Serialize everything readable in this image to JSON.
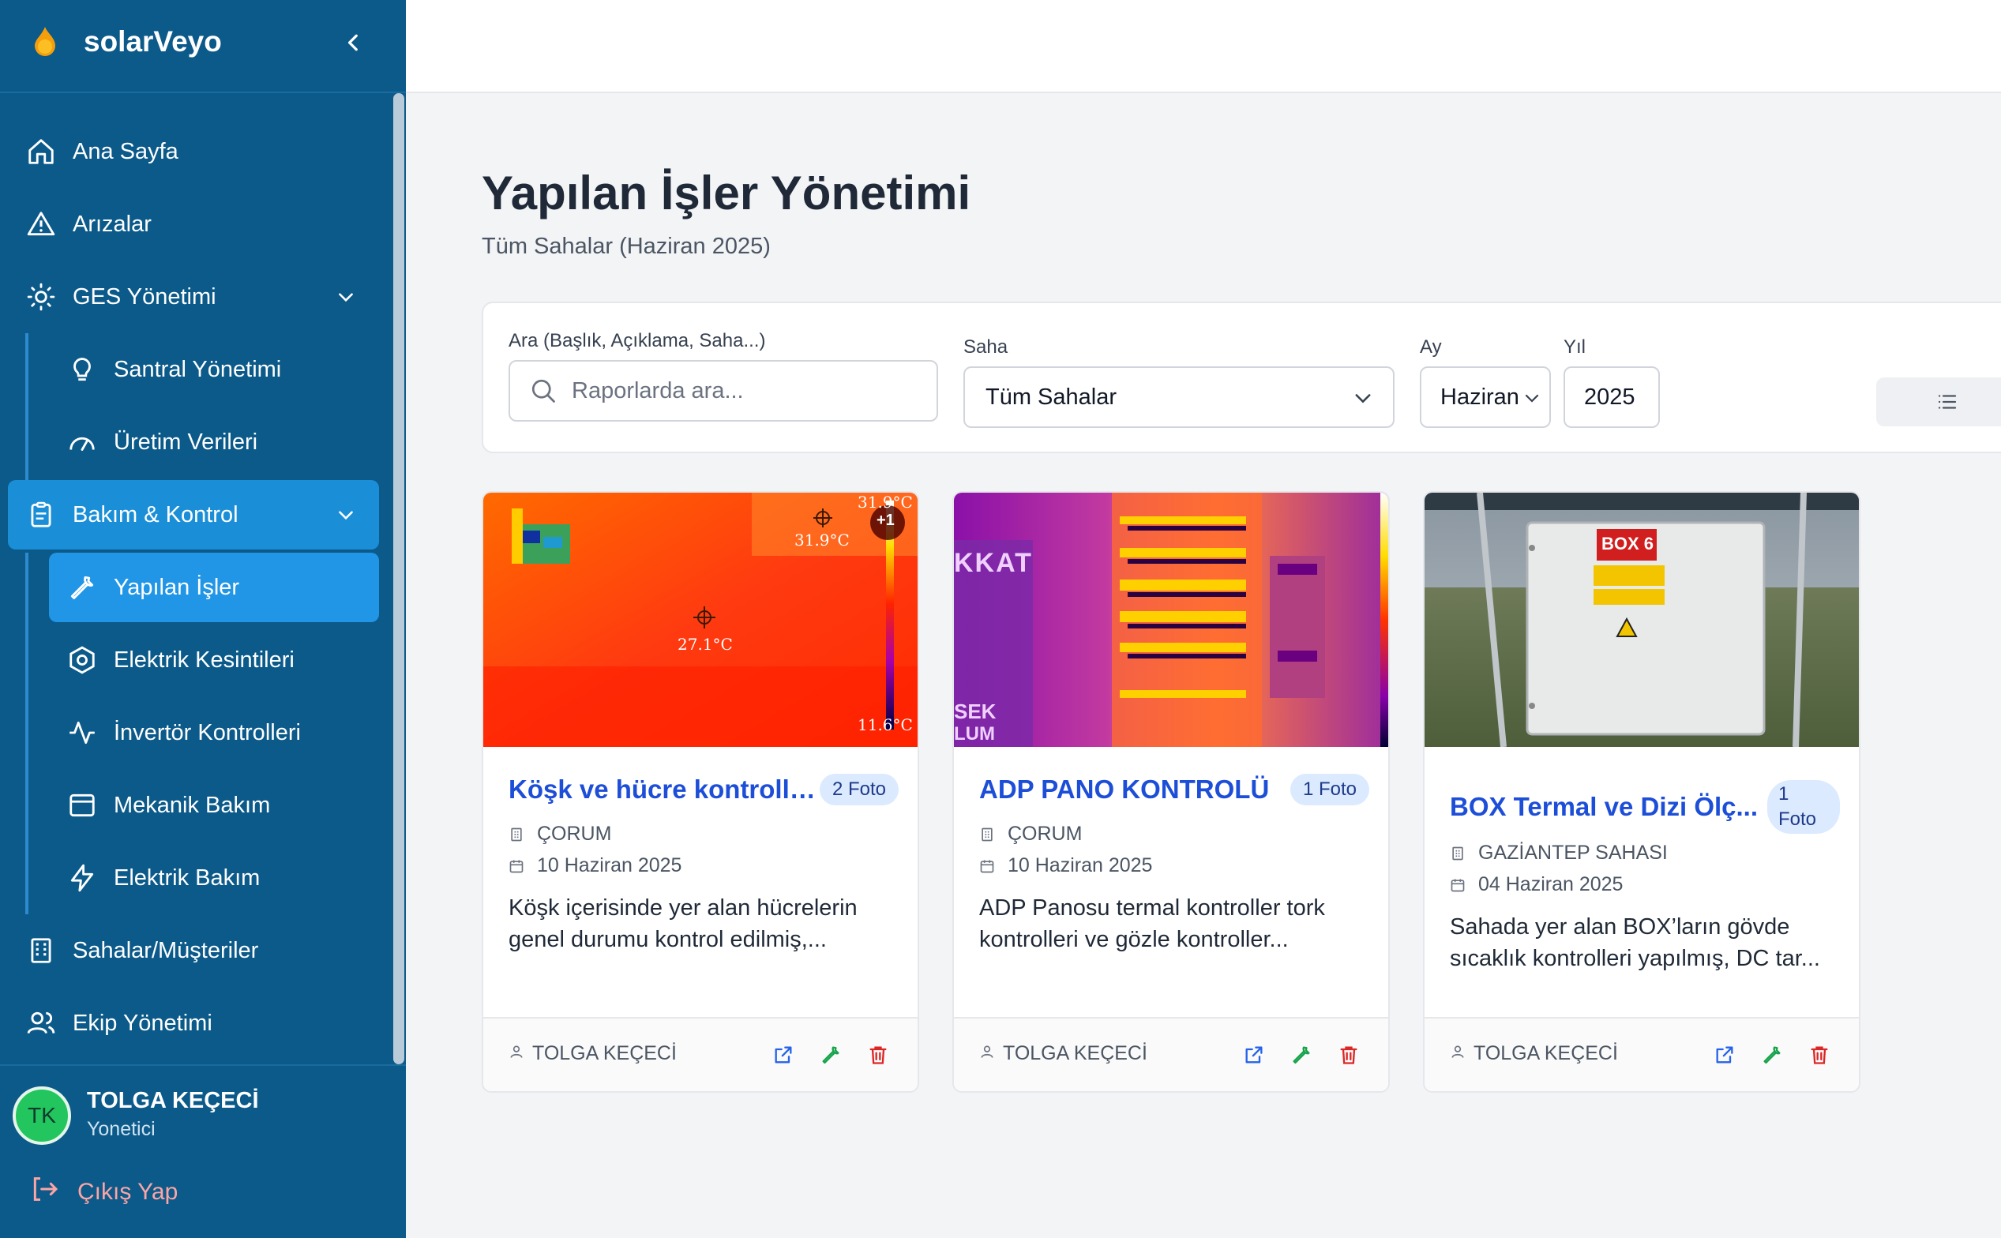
{
  "app": {
    "name": "solarVeyo"
  },
  "sidebar": {
    "items": [
      {
        "label": "Ana Sayfa"
      },
      {
        "label": "Arızalar"
      },
      {
        "label": "GES Yönetimi"
      },
      {
        "label": "Santral Yönetimi"
      },
      {
        "label": "Üretim Verileri"
      },
      {
        "label": "Bakım & Kontrol"
      },
      {
        "label": "Yapılan İşler"
      },
      {
        "label": "Elektrik Kesintileri"
      },
      {
        "label": "İnvertör Kontrolleri"
      },
      {
        "label": "Mekanik Bakım"
      },
      {
        "label": "Elektrik Bakım"
      },
      {
        "label": "Sahalar/Müşteriler"
      },
      {
        "label": "Ekip Yönetimi"
      }
    ]
  },
  "user": {
    "initials": "TK",
    "name": "TOLGA KEÇECİ",
    "role": "Yonetici",
    "logout": "Çıkış Yap"
  },
  "colors": {
    "sidebar": "#0b5a8a",
    "accent": "#1d4ed8",
    "active": "#2196e6",
    "danger": "#dc2626",
    "success": "#16a34a"
  },
  "page": {
    "title": "Yapılan İşler Yönetimi",
    "subtitle": "Tüm Sahalar (Haziran 2025)"
  },
  "filters": {
    "search_label": "Ara (Başlık, Açıklama, Saha...)",
    "search_placeholder": "Raporlarda ara...",
    "site_label": "Saha",
    "site_value": "Tüm Sahalar",
    "month_label": "Ay",
    "month_value": "Haziran",
    "year_label": "Yıl",
    "year_value": "2025"
  },
  "cards": [
    {
      "title": "Köşk ve hücre kontrolleri",
      "photos": "2 Foto",
      "site": "ÇORUM",
      "date": "10 Haziran 2025",
      "desc": "Köşk içerisinde yer alan hücrelerin genel durumu kontrol edilmiş,...",
      "author": "TOLGA KEÇECİ",
      "image": {
        "temp_max": "31.9°C",
        "temp_point": "31.9°C",
        "temp_center": "27.1°C",
        "temp_min": "11.6°C",
        "extra": "+1"
      }
    },
    {
      "title": "ADP PANO KONTROLÜ",
      "photos": "1 Foto",
      "site": "ÇORUM",
      "date": "10 Haziran 2025",
      "desc": "ADP Panosu termal kontroller tork kontrolleri ve gözle kontroller...",
      "author": "TOLGA KEÇECİ",
      "image": {
        "text1": "KKAT",
        "text2": "SEK",
        "text3": "LUM"
      }
    },
    {
      "title": "BOX Termal ve Dizi Ölç...",
      "photos": "1 Foto",
      "site": "GAZİANTEP SAHASI",
      "date": "04 Haziran 2025",
      "desc": "Sahada yer alan BOX’ların gövde sıcaklık kontrolleri yapılmış, DC tar...",
      "author": "TOLGA KEÇECİ",
      "image": {
        "label": "BOX 6"
      }
    }
  ]
}
